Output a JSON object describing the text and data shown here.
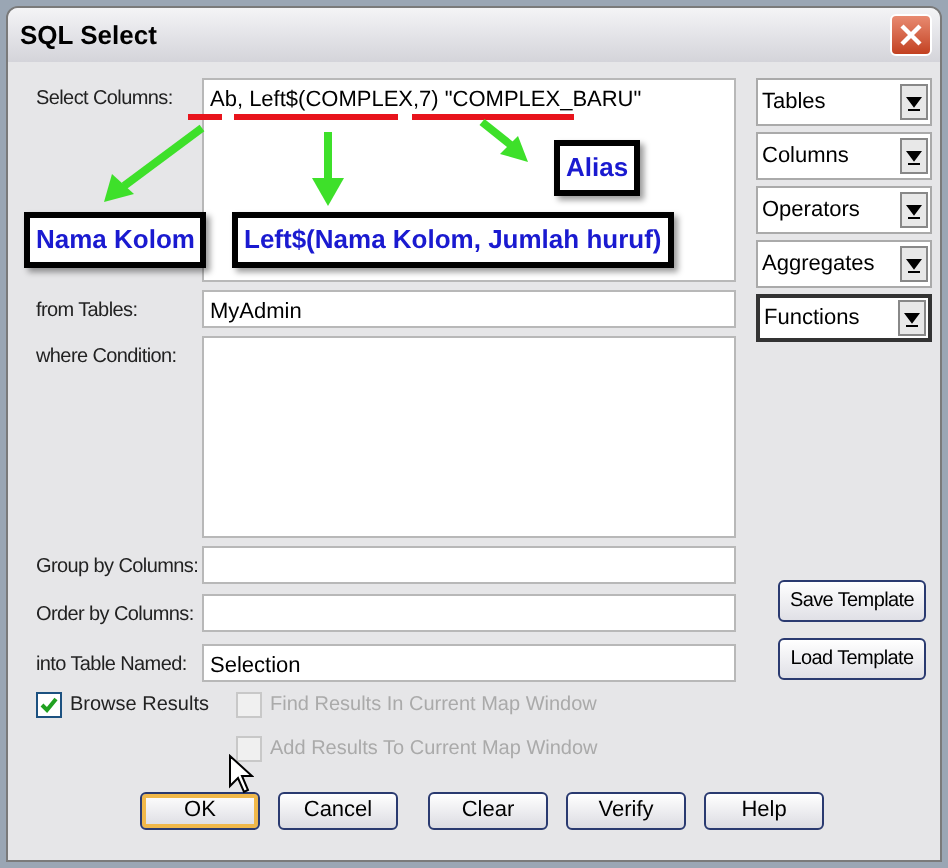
{
  "window": {
    "title": "SQL Select"
  },
  "fields": [
    {
      "label": "Select Columns:",
      "value": "Ab, Left$(COMPLEX,7) \"COMPLEX_BARU\"",
      "kind": "area"
    },
    {
      "label": "from Tables:",
      "value": "MyAdmin",
      "kind": "line"
    },
    {
      "label": "where Condition:",
      "kind": "tall"
    },
    {
      "label": "Group by Columns:",
      "kind": "line"
    },
    {
      "label": "Order by Columns:",
      "kind": "line"
    },
    {
      "label": "into Table Named:",
      "value": "Selection",
      "kind": "line"
    }
  ],
  "pickers": [
    {
      "label": "Tables",
      "focused": false
    },
    {
      "label": "Columns",
      "focused": false
    },
    {
      "label": "Operators",
      "focused": false
    },
    {
      "label": "Aggregates",
      "focused": false
    },
    {
      "label": "Functions",
      "focused": true
    }
  ],
  "template_buttons": [
    "Save Template",
    "Load Template"
  ],
  "checkboxes": [
    {
      "label": "Browse Results",
      "checked": true,
      "disabled": false
    },
    {
      "label": "Find Results In Current Map Window",
      "checked": false,
      "disabled": true
    },
    {
      "label": "Add Results To Current Map Window",
      "checked": false,
      "disabled": true
    }
  ],
  "buttons": [
    {
      "label": "OK",
      "default": true
    },
    {
      "label": "Cancel",
      "default": false
    },
    {
      "label": "Clear",
      "default": false
    },
    {
      "label": "Verify",
      "default": false
    },
    {
      "label": "Help",
      "default": false
    }
  ],
  "annotations": [
    {
      "label": "Nama Kolom",
      "kind": "column"
    },
    {
      "label": "Left$(Nama Kolom, Jumlah huruf)",
      "kind": "function"
    },
    {
      "label": "Alias",
      "kind": "alias"
    }
  ]
}
